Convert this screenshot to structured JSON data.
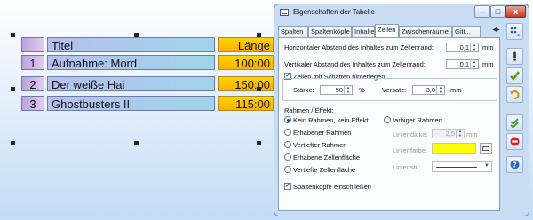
{
  "table": {
    "header": {
      "num": "",
      "title": "Titel",
      "length": "Länge"
    },
    "rows": [
      {
        "num": "1",
        "title": "Aufnahme: Mord",
        "length": "100:00"
      },
      {
        "num": "2",
        "title": "Der weiße Hai",
        "length": "150:00"
      },
      {
        "num": "3",
        "title": "Ghostbusters II",
        "length": "115:00"
      }
    ]
  },
  "dialog": {
    "title": "Eigenschaften der Tabelle",
    "window_buttons": {
      "minimize": "–",
      "maximize": "□",
      "close": "x"
    },
    "tabs": [
      "Spalten",
      "Spaltenköpfe",
      "Inhalte",
      "Zellen",
      "Zwischenräume",
      "Gitt..."
    ],
    "active_tab": "Zellen",
    "zellen": {
      "h_spacing_label": "Horizontaler Abstand des Inhaltes zum Zellenrand:",
      "h_spacing_value": "0,1",
      "h_spacing_unit": "mm",
      "v_spacing_label": "Vertikaler Abstand des Inhaltes zum Zellenrand:",
      "v_spacing_value": "0,1",
      "v_spacing_unit": "mm",
      "shadow_checkbox": "Zellen mit Schatten hinterlegen:",
      "shadow_checked": true,
      "strength_label": "Stärke:",
      "strength_value": "50",
      "strength_unit": "%",
      "offset_label": "Versatz:",
      "offset_value": "3,0",
      "offset_unit": "mm",
      "frame_section": "Rahmen / Effekt:",
      "radios_left": [
        "Kein Rahmen, kein Effekt",
        "Erhabener Rahmen",
        "Vertiefter Rahmen",
        "Erhabene Zellenfläche",
        "Vertiefte Zellenfläche"
      ],
      "radio_right": "farbiger Rahmen",
      "selected_radio": "Kein Rahmen, kein Effekt",
      "line_width_label": "Liniendicke:",
      "line_width_value": "2,5",
      "line_width_unit": "mm",
      "line_color_label": "Linienfarbe:",
      "line_color": "#ffff00",
      "line_style_label": "Linienstil:",
      "header_checkbox": "Spaltenköpfe einschließen",
      "header_checked": true
    },
    "side_buttons": [
      "dots-grid-icon",
      "info-exclamation-icon",
      "checkmark-icon",
      "undo-arrow-icon",
      "double-check-icon",
      "stop-icon",
      "help-icon"
    ]
  },
  "colors": {
    "length_cell": "#ffc000",
    "title_cell": "#a8c8ec",
    "num_cell": "#d0b6e6",
    "line_color_swatch": "#ffff00"
  }
}
